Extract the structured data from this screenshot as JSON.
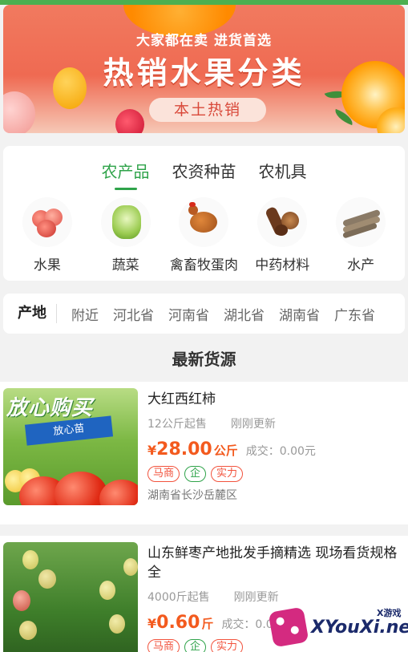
{
  "banner": {
    "subtitle": "大家都在卖 进货首选",
    "title": "热销水果分类",
    "badge": "本土热销"
  },
  "categories": {
    "tabs": [
      {
        "label": "农产品",
        "active": true
      },
      {
        "label": "农资种苗",
        "active": false
      },
      {
        "label": "农机具",
        "active": false
      }
    ],
    "items": [
      {
        "label": "水果",
        "icon": "peach-icon"
      },
      {
        "label": "蔬菜",
        "icon": "cabbage-icon"
      },
      {
        "label": "禽畜牧蛋肉",
        "icon": "chicken-icon"
      },
      {
        "label": "中药材料",
        "icon": "herb-icon"
      },
      {
        "label": "水产",
        "icon": "fish-icon"
      }
    ]
  },
  "region": {
    "label": "产地",
    "options": [
      "附近",
      "河北省",
      "河南省",
      "湖北省",
      "湖南省",
      "广东省"
    ]
  },
  "feed": {
    "title": "最新货源",
    "listings": [
      {
        "name": "大红西红柿",
        "min_order": "12公斤起售",
        "updated": "刚刚更新",
        "currency": "¥",
        "price": "28.00",
        "unit": "公斤",
        "deal": "成交：0.00元",
        "tags": [
          "马商",
          "企",
          "实力"
        ],
        "location": "湖南省长沙岳麓区",
        "image": {
          "headline": "放心购买",
          "ribbon": "放心苗"
        }
      },
      {
        "name": "山东鲜枣产地批发手摘精选 现场看货规格全",
        "min_order": "4000斤起售",
        "updated": "刚刚更新",
        "currency": "¥",
        "price": "0.60",
        "unit": "斤",
        "deal": "成交：0.00元",
        "tags": [
          "马商",
          "企",
          "实力"
        ]
      }
    ]
  },
  "watermark": {
    "text": "XYouXi.net",
    "small": "X游戏"
  },
  "colors": {
    "accent": "#2fa34a",
    "price": "#f35a1e",
    "tag": "#f2533d",
    "banner": "#ef6a52"
  }
}
